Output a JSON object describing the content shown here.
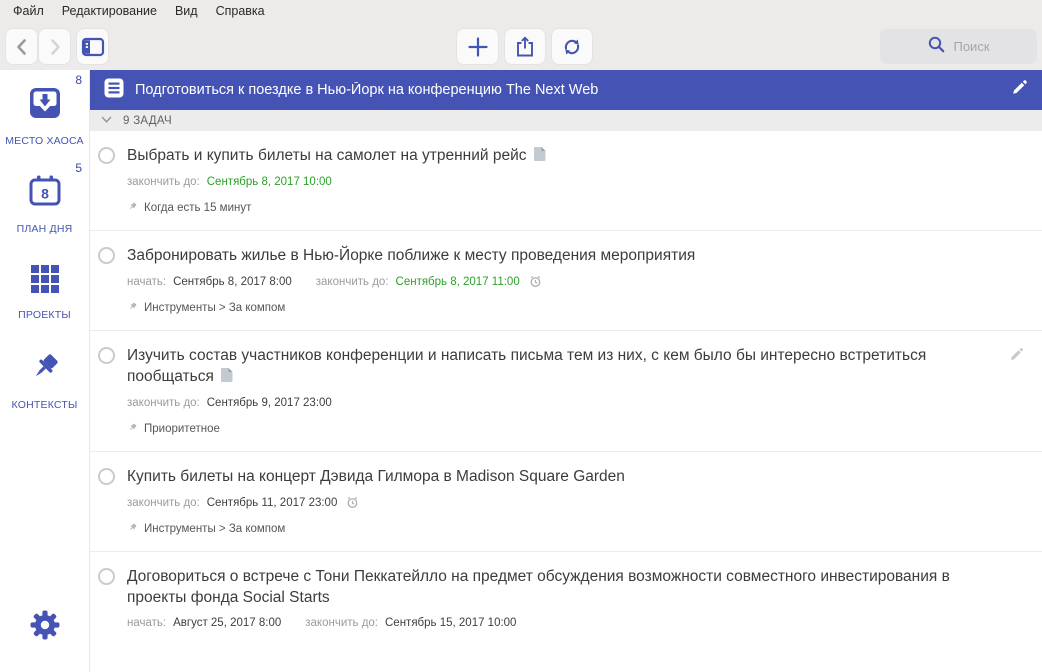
{
  "menubar": {
    "items": [
      "Файл",
      "Редактирование",
      "Вид",
      "Справка"
    ]
  },
  "toolbar": {
    "search_placeholder": "Поиск"
  },
  "sidebar": {
    "items": [
      {
        "id": "inbox",
        "label": "МЕСТО ХАОСА",
        "badge": "8",
        "icon": "inbox-icon"
      },
      {
        "id": "day-plan",
        "label": "ПЛАН ДНЯ",
        "badge": "5",
        "icon": "calendar-icon",
        "calendar_day": "8"
      },
      {
        "id": "projects",
        "label": "ПРОЕКТЫ",
        "badge": "",
        "icon": "projects-grid-icon"
      },
      {
        "id": "contexts",
        "label": "КОНТЕКСТЫ",
        "badge": "",
        "icon": "pin-icon"
      }
    ]
  },
  "project_header": {
    "title": "Подготовиться к поездке в Нью-Йорк на конференцию The Next Web"
  },
  "section_header": {
    "label": "9 ЗАДАЧ"
  },
  "labels": {
    "start": "начать:",
    "due": "закончить до:"
  },
  "tasks": [
    {
      "title": "Выбрать и купить билеты на самолет на утренний рейс",
      "has_note": true,
      "due": "Сентябрь 8, 2017 10:00",
      "due_green": true,
      "context": "Когда есть 15 минут"
    },
    {
      "title": "Забронировать жилье в Нью-Йорке поближе к месту проведения мероприятия",
      "start": "Сентябрь 8, 2017 8:00",
      "due": "Сентябрь 8, 2017 11:00",
      "due_green": true,
      "has_alarm": true,
      "context": "Инструменты > За компом"
    },
    {
      "title": "Изучить состав участников конференции и написать письма тем из них, с кем было бы интересно встретиться пообщаться",
      "has_note": true,
      "due": "Сентябрь 9, 2017 23:00",
      "due_green": false,
      "context": "Приоритетное",
      "has_edit": true
    },
    {
      "title": "Купить билеты на концерт Дэвида Гилмора в Madison Square Garden",
      "due": "Сентябрь 11, 2017 23:00",
      "due_green": false,
      "has_alarm": true,
      "context": "Инструменты > За компом"
    },
    {
      "title": "Договориться о встрече с Тони Пеккатейлло на предмет обсуждения возможности совместного инвестирования в проекты фонда Social Starts",
      "start": "Август 25, 2017 8:00",
      "due": "Сентябрь 15, 2017 10:00",
      "due_green": false
    }
  ],
  "colors": {
    "accent_blue": "#4554b4",
    "due_green": "#2aa22a",
    "header_bg": "#4554b4",
    "toolbar_bg": "#ecebe9"
  }
}
